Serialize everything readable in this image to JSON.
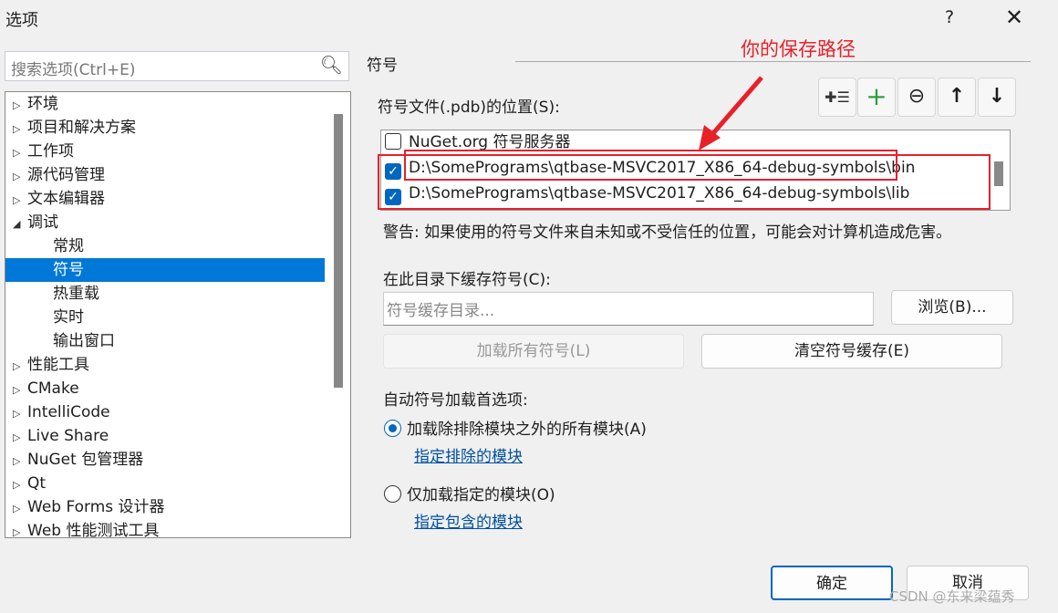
{
  "window": {
    "title": "选项",
    "help": "?",
    "close": "✕"
  },
  "search": {
    "placeholder": "搜索选项(Ctrl+E)"
  },
  "tree": {
    "items": [
      {
        "label": "环境",
        "expander": "collapsed"
      },
      {
        "label": "项目和解决方案",
        "expander": "collapsed"
      },
      {
        "label": "工作项",
        "expander": "collapsed"
      },
      {
        "label": "源代码管理",
        "expander": "collapsed"
      },
      {
        "label": "文本编辑器",
        "expander": "collapsed"
      },
      {
        "label": "调试",
        "expander": "expanded"
      },
      {
        "label": "常规",
        "child": true
      },
      {
        "label": "符号",
        "child": true,
        "selected": true
      },
      {
        "label": "热重载",
        "child": true
      },
      {
        "label": "实时",
        "child": true
      },
      {
        "label": "输出窗口",
        "child": true
      },
      {
        "label": "性能工具",
        "expander": "collapsed"
      },
      {
        "label": "CMake",
        "expander": "collapsed"
      },
      {
        "label": "IntelliCode",
        "expander": "collapsed"
      },
      {
        "label": "Live Share",
        "expander": "collapsed"
      },
      {
        "label": "NuGet 包管理器",
        "expander": "collapsed"
      },
      {
        "label": "Qt",
        "expander": "collapsed"
      },
      {
        "label": "Web Forms 设计器",
        "expander": "collapsed"
      },
      {
        "label": "Web 性能测试工具",
        "expander": "collapsed"
      }
    ]
  },
  "section": {
    "title": "符号",
    "locations_label": "符号文件(.pdb)的位置(S):"
  },
  "toolbar": [
    "add-server-icon",
    "add-icon",
    "remove-icon",
    "move-up-icon",
    "move-down-icon"
  ],
  "locations": [
    {
      "label": "NuGet.org 符号服务器",
      "checked": false
    },
    {
      "label": "D:\\SomePrograms\\qtbase-MSVC2017_X86_64-debug-symbols\\bin",
      "checked": true
    },
    {
      "label": "D:\\SomePrograms\\qtbase-MSVC2017_X86_64-debug-symbols\\lib",
      "checked": true
    }
  ],
  "warning": "警告: 如果使用的符号文件来自未知或不受信任的位置，可能会对计算机造成危害。",
  "cache": {
    "label": "在此目录下缓存符号(C):",
    "placeholder": "符号缓存目录...",
    "browse": "浏览(B)...",
    "load_all": "加载所有符号(L)",
    "clear": "清空符号缓存(E)"
  },
  "auto": {
    "label": "自动符号加载首选项:",
    "option1": "加载除排除模块之外的所有模块(A)",
    "link1": "指定排除的模块",
    "option2": "仅加载指定的模块(O)",
    "link2": "指定包含的模块",
    "selected": "option1"
  },
  "footer": {
    "ok": "确定",
    "cancel": "取消"
  },
  "annotation": "你的保存路径",
  "watermark": "CSDN @东来梁蕴秀",
  "colors": {
    "selection": "#0078d7",
    "annotation": "#e8202a",
    "link": "#0050a0"
  }
}
